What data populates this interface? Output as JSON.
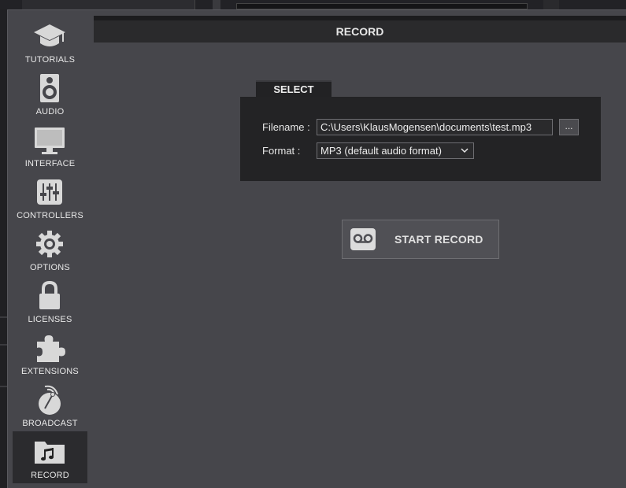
{
  "sidebar": {
    "items": [
      {
        "label": "TUTORIALS",
        "icon": "graduation-cap-icon",
        "active": false
      },
      {
        "label": "AUDIO",
        "icon": "speaker-icon",
        "active": false
      },
      {
        "label": "INTERFACE",
        "icon": "monitor-icon",
        "active": false
      },
      {
        "label": "CONTROLLERS",
        "icon": "sliders-icon",
        "active": false
      },
      {
        "label": "OPTIONS",
        "icon": "gear-icon",
        "active": false
      },
      {
        "label": "LICENSES",
        "icon": "lock-icon",
        "active": false
      },
      {
        "label": "EXTENSIONS",
        "icon": "puzzle-icon",
        "active": false
      },
      {
        "label": "BROADCAST",
        "icon": "satellite-dish-icon",
        "active": false
      },
      {
        "label": "RECORD",
        "icon": "music-folder-icon",
        "active": true
      }
    ]
  },
  "header": {
    "title": "RECORD"
  },
  "select_section": {
    "tab_label": "SELECT",
    "filename_label": "Filename :",
    "filename_value": "C:\\Users\\KlausMogensen\\documents\\test.mp3",
    "browse_label": "...",
    "format_label": "Format :",
    "format_value": "MP3 (default audio format)"
  },
  "record_button": {
    "label": "START RECORD",
    "icon": "voicemail-icon"
  },
  "colors": {
    "panel_bg": "#46464b",
    "dark_panel": "#232325",
    "text": "#e6e6e6"
  }
}
